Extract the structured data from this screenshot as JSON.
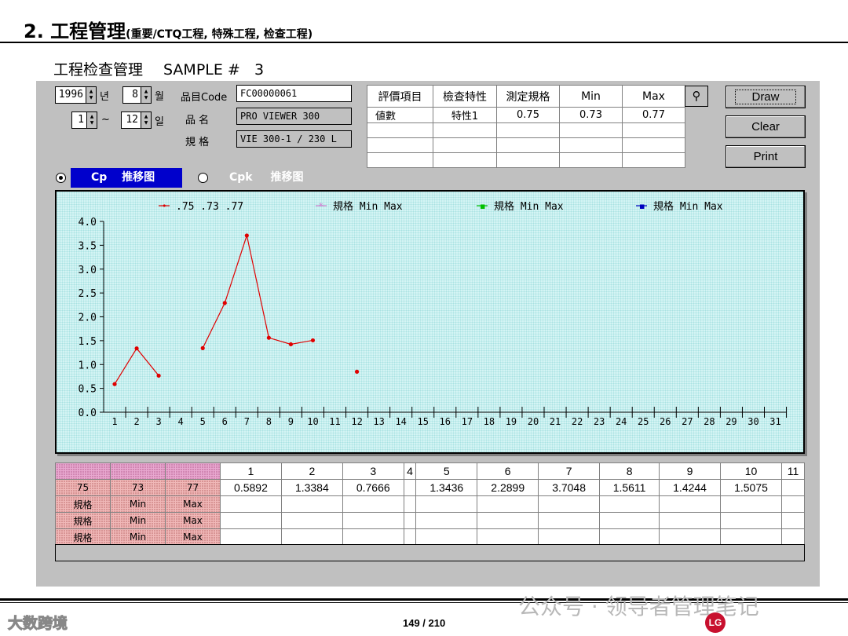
{
  "slide": {
    "title_main": "2. 工程管理",
    "title_sub": "(重要/CTQ工程, 特殊工程, 检查工程)",
    "section": "工程检查管理",
    "sample_label": "SAMPLE #",
    "sample_no": "3",
    "page": "149 / 210",
    "watermark_left": "大数跨境",
    "watermark_right": "公众号 · 领导者管理笔记",
    "logo": "LG"
  },
  "filters": {
    "year": "1996",
    "year_unit": "년",
    "month": "8",
    "month_unit": "월",
    "from_month": "1",
    "tilde": "~",
    "to_month": "12",
    "to_unit": "일"
  },
  "product": {
    "code_label": "品目Code",
    "code": "FC00000061",
    "name_label": "品 名",
    "name": "PRO VIEWER 300",
    "spec_label": "規 格",
    "spec": "VIE 300-1 / 230 L"
  },
  "spec_table": {
    "headers": [
      "評價項目",
      "檢查特性",
      "測定規格",
      "Min",
      "Max"
    ],
    "row": [
      "値數",
      "特性1",
      "0.75",
      "0.73",
      "0.77"
    ]
  },
  "buttons": {
    "draw": "Draw",
    "clear": "Clear",
    "print": "Print"
  },
  "tabs": {
    "cp": "Cp",
    "cp_trend": "推移图",
    "cpk": "Cpk",
    "cpk_trend": "推移图"
  },
  "legend": [
    {
      "marker": "•",
      "text": ".75  .73  .77",
      "color": "#e00000"
    },
    {
      "marker": "*",
      "text": "規格  Min Max",
      "color": "#d080d0"
    },
    {
      "marker": "▪",
      "text": "規格  Min Max",
      "color": "#00c000"
    },
    {
      "marker": "▪",
      "text": "規格  Min Max",
      "color": "#0000c0"
    }
  ],
  "chart_data": {
    "type": "line",
    "x": [
      1,
      2,
      3,
      4,
      5,
      6,
      7,
      8,
      9,
      10,
      11,
      12,
      13,
      14,
      15,
      16,
      17,
      18,
      19,
      20,
      21,
      22,
      23,
      24,
      25,
      26,
      27,
      28,
      29,
      30,
      31
    ],
    "series": [
      {
        "name": ".75  .73  .77",
        "values": [
          0.5892,
          1.3384,
          0.7666,
          null,
          1.3436,
          2.2899,
          3.7048,
          1.5611,
          1.4244,
          1.5075,
          null,
          0.85,
          null,
          null,
          null,
          null,
          null,
          null,
          null,
          null,
          null,
          null,
          null,
          null,
          null,
          null,
          null,
          null,
          null,
          null,
          null
        ]
      }
    ],
    "ylim": [
      0,
      4.0
    ],
    "yticks": [
      "0.0",
      "0.5",
      "1.0",
      "1.5",
      "2.0",
      "2.5",
      "3.0",
      "3.5",
      "4.0"
    ],
    "line_color": "#e00000"
  },
  "grid": {
    "fixed_rows": [
      [
        "75",
        "73",
        "77"
      ],
      [
        "規格",
        "Min",
        "Max"
      ],
      [
        "規格",
        "Min",
        "Max"
      ],
      [
        "規格",
        "Min",
        "Max"
      ]
    ],
    "columns": [
      "1",
      "2",
      "3",
      "4",
      "5",
      "6",
      "7",
      "8",
      "9",
      "10",
      "11"
    ],
    "values": [
      "0.5892",
      "1.3384",
      "0.7666",
      "",
      "1.3436",
      "2.2899",
      "3.7048",
      "1.5611",
      "1.4244",
      "1.5075",
      ""
    ]
  }
}
